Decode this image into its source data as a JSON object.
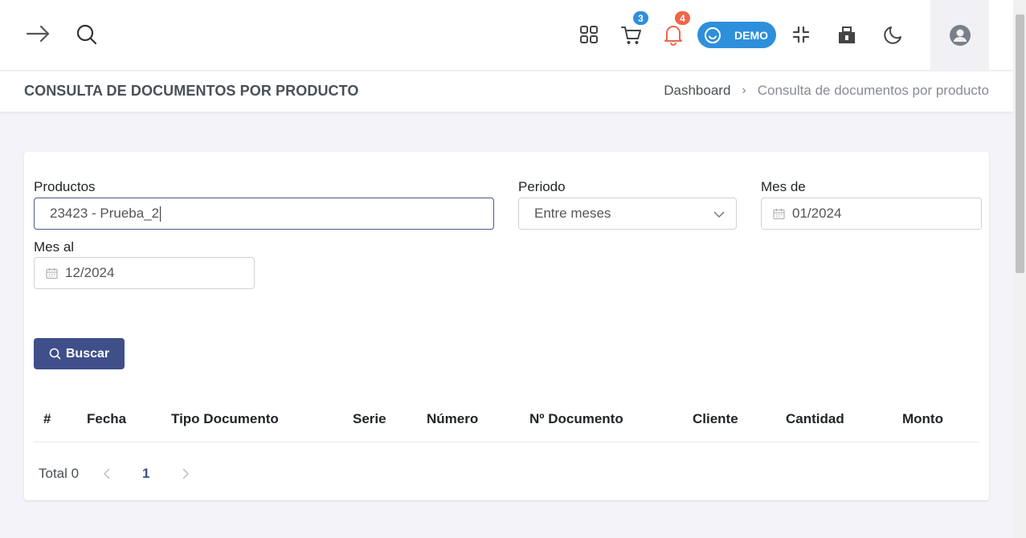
{
  "header": {
    "cart_badge": "3",
    "notifications_badge": "4",
    "demo_label": "DEMO",
    "cart_badge_color": "#2e8fdc",
    "notifications_badge_color": "#f06548"
  },
  "page": {
    "title": "CONSULTA DE DOCUMENTOS POR PRODUCTO",
    "breadcrumb": {
      "home": "Dashboard",
      "separator": "›",
      "current": "Consulta de documentos por producto"
    }
  },
  "form": {
    "productos_label": "Productos",
    "productos_value": "23423 - Prueba_2",
    "periodo_label": "Periodo",
    "periodo_value": "Entre meses",
    "mes_de_label": "Mes de",
    "mes_de_value": "01/2024",
    "mes_al_label": "Mes al",
    "mes_al_value": "12/2024",
    "search_button": "Buscar"
  },
  "table": {
    "columns": [
      "#",
      "Fecha",
      "Tipo Documento",
      "Serie",
      "Número",
      "Nº Documento",
      "Cliente",
      "Cantidad",
      "Monto"
    ],
    "rows": []
  },
  "pagination": {
    "total_label": "Total 0",
    "current_page": "1"
  },
  "colors": {
    "primary": "#3f4f8a",
    "demo": "#2e8fdc"
  }
}
